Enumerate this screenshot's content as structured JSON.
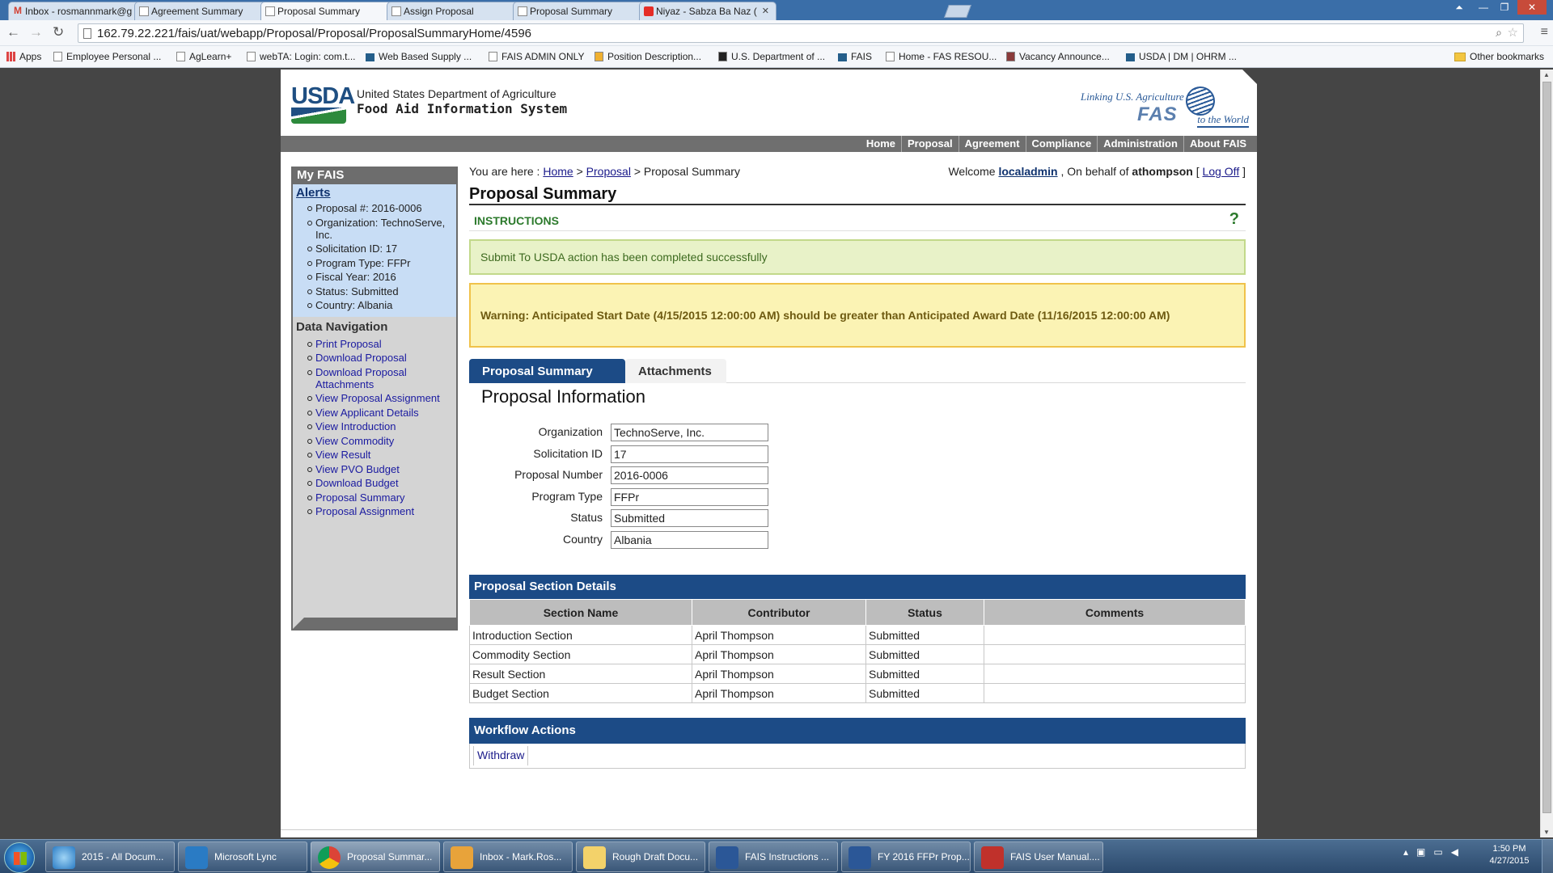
{
  "browser": {
    "tabs": [
      {
        "label": "Inbox - rosmannmark@g",
        "active": false
      },
      {
        "label": "Agreement Summary",
        "active": false
      },
      {
        "label": "Proposal Summary",
        "active": true
      },
      {
        "label": "Assign Proposal",
        "active": false
      },
      {
        "label": "Proposal Summary",
        "active": false
      },
      {
        "label": "Niyaz - Sabza Ba Naz (",
        "active": false
      }
    ],
    "url": "162.79.22.221/fais/uat/webapp/Proposal/Proposal/ProposalSummaryHome/4596",
    "bookmarks": [
      "Apps",
      "Employee Personal ...",
      "AgLearn+",
      "webTA: Login: com.t...",
      "Web Based Supply ...",
      "FAIS ADMIN ONLY",
      "Position Description...",
      "U.S. Department of ...",
      "FAIS",
      "Home - FAS RESOU...",
      "Vacancy Announce...",
      "USDA | DM | OHRM ..."
    ],
    "other_bookmarks": "Other bookmarks"
  },
  "header": {
    "logo_text": "USDA",
    "department": "United States Department of Agriculture",
    "system_name": "Food Aid Information System",
    "fas_tagline": "Linking U.S. Agriculture",
    "fas_text": "FAS",
    "fas_world": "to the World"
  },
  "topnav": [
    "Home",
    "Proposal",
    "Agreement",
    "Compliance",
    "Administration",
    "About FAIS"
  ],
  "sidebar": {
    "title": "My FAIS",
    "alerts_heading": "Alerts",
    "alerts": [
      "Proposal #: 2016-0006",
      "Organization: TechnoServe, Inc.",
      "Solicitation ID: 17",
      "Program Type: FFPr",
      "Fiscal Year: 2016",
      "Status: Submitted",
      "Country: Albania"
    ],
    "data_nav_heading": "Data Navigation",
    "data_nav": [
      "Print Proposal",
      "Download Proposal",
      "Download Proposal Attachments",
      "View Proposal Assignment",
      "View Applicant Details",
      "View Introduction",
      "View Commodity",
      "View Result",
      "View PVO Budget",
      "Download Budget",
      "Proposal Summary",
      "Proposal Assignment"
    ]
  },
  "breadcrumb": {
    "prefix": "You are here :",
    "home": "Home",
    "sep1": ">",
    "proposal": "Proposal",
    "sep2": ">",
    "current": "Proposal Summary"
  },
  "welcome": {
    "prefix": "Welcome",
    "user": "localadmin",
    "behalf": ", On behalf of",
    "behalf_user": "athompson",
    "open": "[",
    "logoff": "Log Off",
    "close": "]"
  },
  "page_title": "Proposal Summary",
  "instructions": {
    "label": "INSTRUCTIONS",
    "help": "?"
  },
  "success_message": "Submit To USDA action has been completed successfully",
  "warning_message": "Warning: Anticipated Start Date (4/15/2015 12:00:00 AM) should be greater than Anticipated Award Date (11/16/2015 12:00:00 AM)",
  "tabs": {
    "summary": "Proposal Summary",
    "attachments": "Attachments"
  },
  "proposal_info": {
    "title": "Proposal Information",
    "fields": [
      {
        "label": "Organization",
        "value": "TechnoServe, Inc."
      },
      {
        "label": "Solicitation ID",
        "value": "17"
      },
      {
        "label": "Proposal Number",
        "value": "2016-0006"
      },
      {
        "label": "Program Type",
        "value": "FFPr"
      },
      {
        "label": "Status",
        "value": "Submitted"
      },
      {
        "label": "Country",
        "value": "Albania"
      }
    ]
  },
  "section_details": {
    "title": "Proposal Section Details",
    "columns": [
      "Section Name",
      "Contributor",
      "Status",
      "Comments"
    ],
    "rows": [
      [
        "Introduction Section",
        "April Thompson",
        "Submitted",
        ""
      ],
      [
        "Commodity Section",
        "April Thompson",
        "Submitted",
        ""
      ],
      [
        "Result Section",
        "April Thompson",
        "Submitted",
        ""
      ],
      [
        "Budget Section",
        "April Thompson",
        "Submitted",
        ""
      ]
    ]
  },
  "workflow": {
    "title": "Workflow Actions",
    "withdraw": "Withdraw"
  },
  "taskbar": {
    "items": [
      {
        "label": "2015 - All Docum...",
        "icon": "ie-icon"
      },
      {
        "label": "Microsoft Lync",
        "icon": "lync-icon"
      },
      {
        "label": "Proposal Summar...",
        "icon": "chrome-icon"
      },
      {
        "label": "Inbox - Mark.Ros...",
        "icon": "outlook-icon"
      },
      {
        "label": "Rough Draft Docu...",
        "icon": "folder-icon"
      },
      {
        "label": "FAIS Instructions ...",
        "icon": "word-icon"
      },
      {
        "label": "FY 2016 FFPr Prop...",
        "icon": "word-icon"
      },
      {
        "label": "FAIS User Manual....",
        "icon": "pdf-icon"
      }
    ],
    "time": "1:50 PM",
    "date": "4/27/2015"
  },
  "colors": {
    "nav_blue": "#1c4b86",
    "success_bg": "#e8f2c8",
    "warning_bg": "#fbf3b4",
    "instructions_green": "#2c7a2c"
  }
}
